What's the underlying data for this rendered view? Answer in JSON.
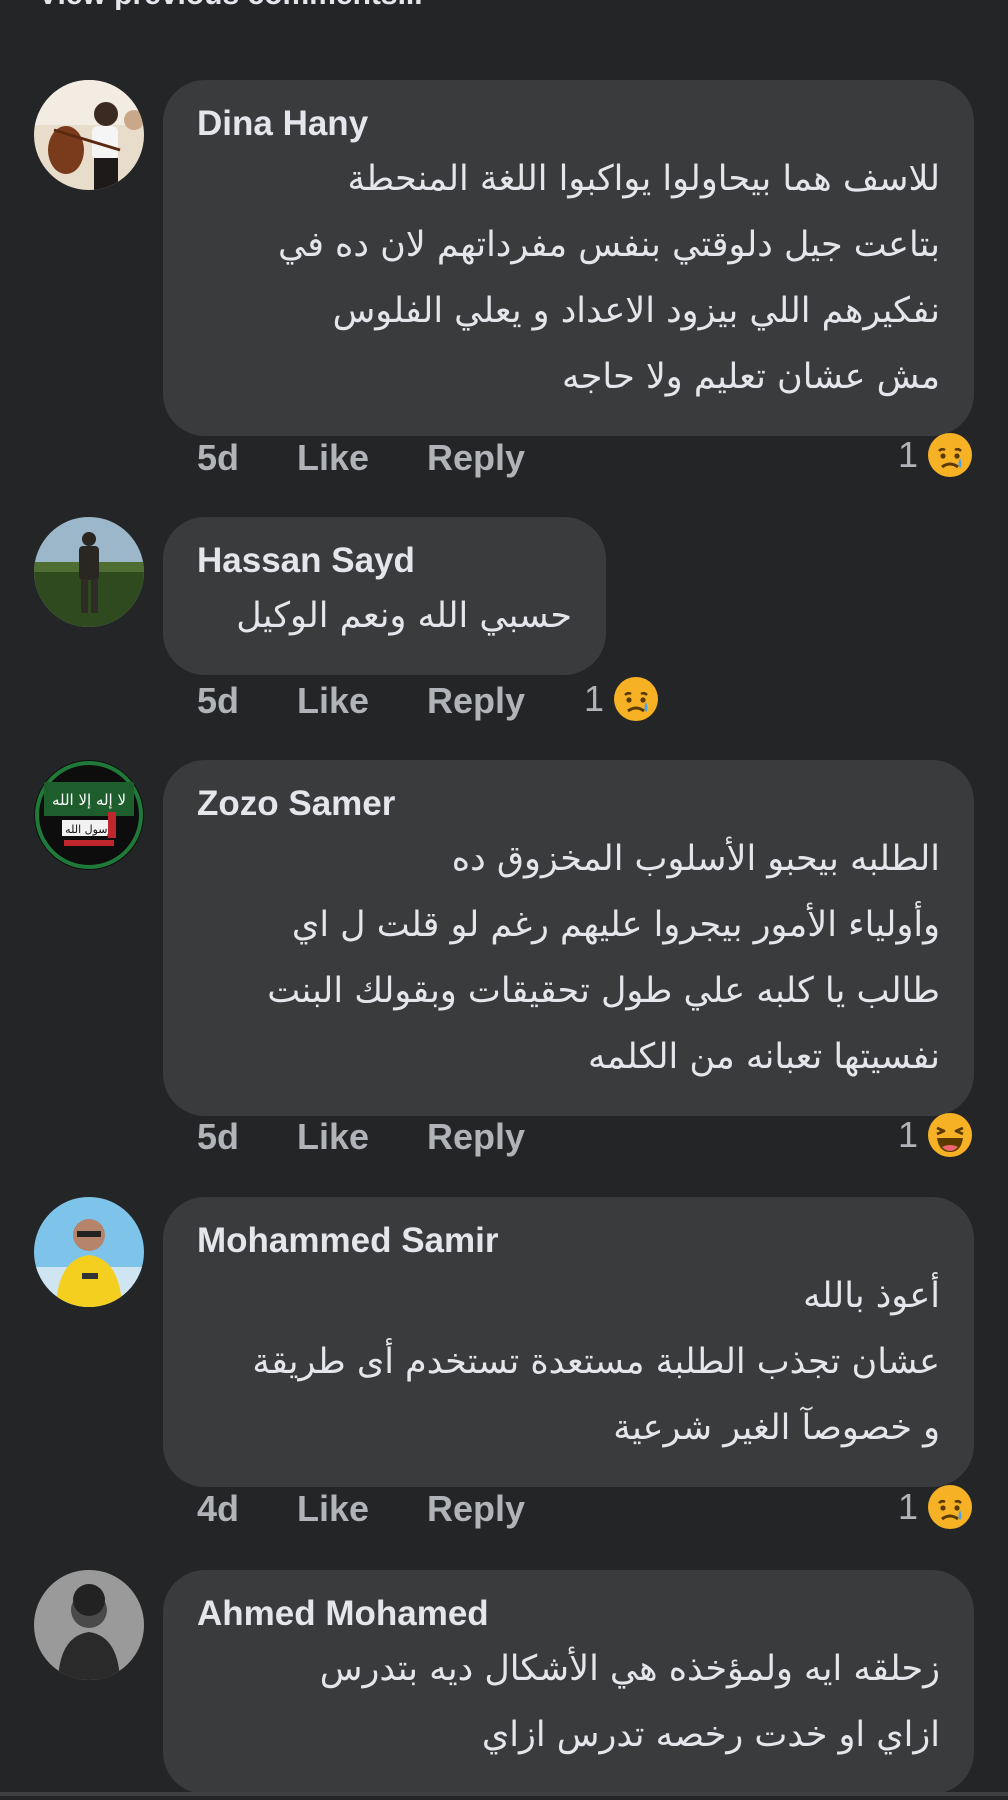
{
  "header": {
    "view_previous": "View previous comments..."
  },
  "comments": [
    {
      "author": "Dina Hany",
      "lines": [
        "للاسف هما بيحاولوا يواكبوا اللغة المنحطة",
        "بتاعت جيل دلوقتي بنفس مفرداتهم لان ده في",
        "نفكيرهم اللي بيزود الاعداد و يعلي الفلوس",
        "مش عشان تعليم ولا حاجه"
      ],
      "time": "5d",
      "like": "Like",
      "reply": "Reply",
      "reaction_count": "1",
      "reaction_icon": "sad-emoji-icon"
    },
    {
      "author": "Hassan Sayd",
      "lines": [
        "حسبي الله ونعم الوكيل"
      ],
      "time": "5d",
      "like": "Like",
      "reply": "Reply",
      "reaction_count": "1",
      "reaction_icon": "sad-emoji-icon"
    },
    {
      "author": "Zozo Samer",
      "lines": [
        "الطلبه بيحبو الأسلوب المخزوق ده",
        "وأولياء الأمور بيجروا عليهم رغم لو قلت ل اي",
        "طالب يا كلبه علي طول تحقيقات وبقولك البنت",
        "نفسيتها تعبانه من الكلمه"
      ],
      "avatar_text": "لا إله إلا الله",
      "avatar_text_2": "رسول الله",
      "time": "5d",
      "like": "Like",
      "reply": "Reply",
      "reaction_count": "1",
      "reaction_icon": "laughing-emoji-icon"
    },
    {
      "author": "Mohammed Samir",
      "lines": [
        "أعوذ بالله",
        "عشان تجذب الطلبة مستعدة تستخدم أى طريقة",
        "و خصوصآ الغير شرعية"
      ],
      "time": "4d",
      "like": "Like",
      "reply": "Reply",
      "reaction_count": "1",
      "reaction_icon": "sad-emoji-icon"
    },
    {
      "author": "Ahmed Mohamed",
      "lines": [
        "زحلقه ايه ولمؤخذه هي الأشكال ديه بتدرس",
        "ازاي او خدت رخصه تدرس ازاي"
      ]
    }
  ],
  "colors": {
    "background": "#242526",
    "bubble": "#3a3b3c",
    "text": "#e4e6eb",
    "muted": "#b0b3b8",
    "emoji_yellow": "#f7b125"
  }
}
